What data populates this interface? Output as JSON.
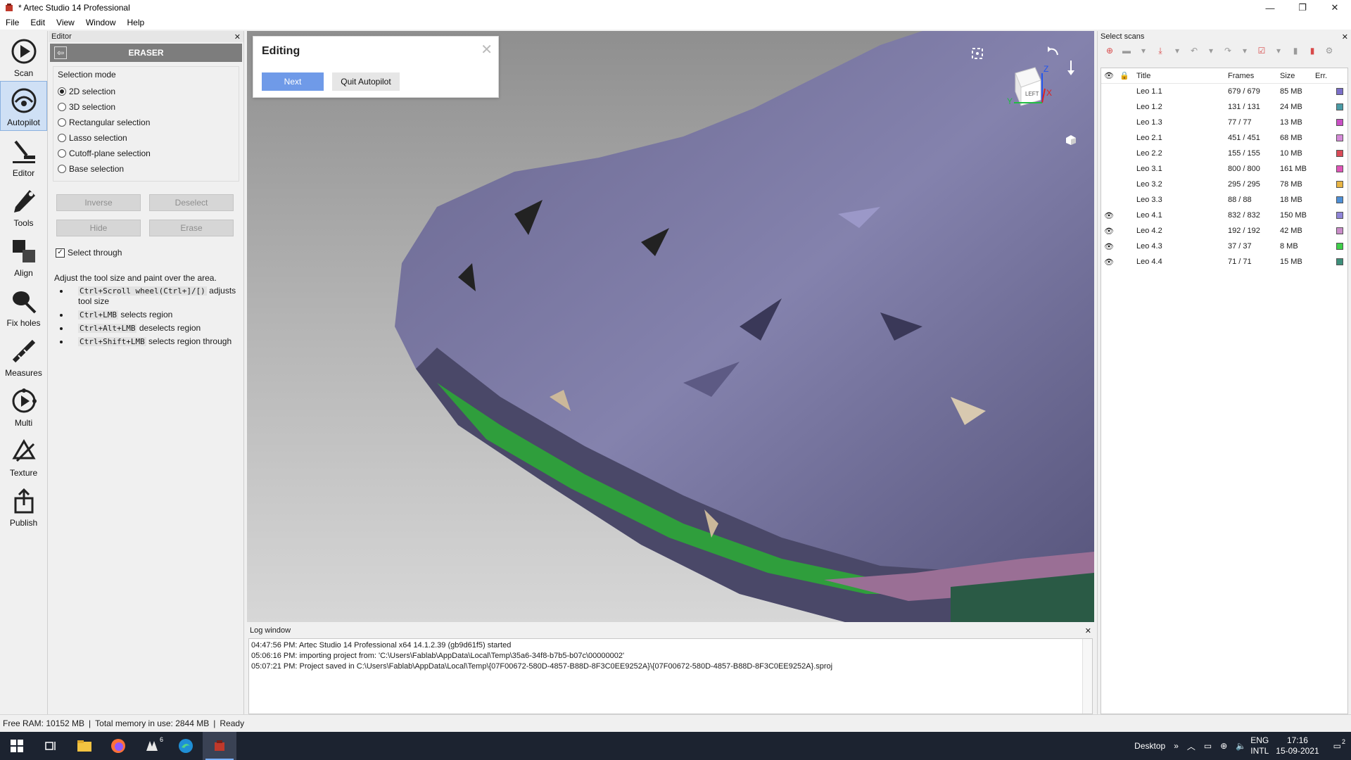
{
  "window": {
    "title": "* Artec Studio 14 Professional",
    "controls": [
      "—",
      "❐",
      "✕"
    ]
  },
  "menu": [
    "File",
    "Edit",
    "View",
    "Window",
    "Help"
  ],
  "tools": [
    {
      "label": "Scan",
      "icon": "scan-icon"
    },
    {
      "label": "Autopilot",
      "icon": "autopilot-icon",
      "active": true
    },
    {
      "label": "Editor",
      "icon": "editor-icon"
    },
    {
      "label": "Tools",
      "icon": "tools-icon"
    },
    {
      "label": "Align",
      "icon": "align-icon"
    },
    {
      "label": "Fix holes",
      "icon": "fix-holes-icon"
    },
    {
      "label": "Measures",
      "icon": "measures-icon"
    },
    {
      "label": "Multi",
      "icon": "multi-icon"
    },
    {
      "label": "Texture",
      "icon": "texture-icon"
    },
    {
      "label": "Publish",
      "icon": "publish-icon"
    }
  ],
  "editor": {
    "panel_title": "Editor",
    "mode_title": "ERASER",
    "selection_header": "Selection mode",
    "modes": [
      "2D selection",
      "3D selection",
      "Rectangular selection",
      "Lasso selection",
      "Cutoff-plane selection",
      "Base selection"
    ],
    "selected_mode": 0,
    "buttons": {
      "inverse": "Inverse",
      "deselect": "Deselect",
      "hide": "Hide",
      "erase": "Erase"
    },
    "select_through": "Select through",
    "help_intro": "Adjust the tool size and paint over the area.",
    "help_items": [
      {
        "keys": "Ctrl+Scroll wheel(Ctrl+]/[)",
        "text": " adjusts tool size"
      },
      {
        "keys": "Ctrl+LMB",
        "text": " selects region"
      },
      {
        "keys": "Ctrl+Alt+LMB",
        "text": " deselects region"
      },
      {
        "keys": "Ctrl+Shift+LMB",
        "text": " selects region through"
      }
    ]
  },
  "dialog": {
    "title": "Editing",
    "next": "Next",
    "quit": "Quit Autopilot",
    "close": "✕"
  },
  "viewcube": {
    "face": "LEFT",
    "axis_z": "Z",
    "axis_x": "X",
    "axis_y": "Y"
  },
  "log": {
    "title": "Log window",
    "lines": [
      "04:47:56 PM: Artec Studio 14 Professional x64 14.1.2.39 (gb9d61f5) started",
      "05:06:16 PM: importing project from: 'C:\\Users\\Fablab\\AppData\\Local\\Temp\\35a6-34f8-b7b5-b07c\\00000002'",
      "05:07:21 PM: Project saved in C:\\Users\\Fablab\\AppData\\Local\\Temp\\{07F00672-580D-4857-B88D-8F3C0EE9252A}\\{07F00672-580D-4857-B88D-8F3C0EE9252A}.sproj"
    ]
  },
  "scans": {
    "panel_title": "Select scans",
    "headers": {
      "title": "Title",
      "frames": "Frames",
      "size": "Size",
      "err": "Err."
    },
    "rows": [
      {
        "title": "Leo 1.1",
        "frames": "679 / 679",
        "size": "85 MB",
        "visible": false,
        "color": "#7b6fc9"
      },
      {
        "title": "Leo 1.2",
        "frames": "131 / 131",
        "size": "24 MB",
        "visible": false,
        "color": "#4a9ba6"
      },
      {
        "title": "Leo 1.3",
        "frames": "77 / 77",
        "size": "13 MB",
        "visible": false,
        "color": "#c94fc4"
      },
      {
        "title": "Leo 2.1",
        "frames": "451 / 451",
        "size": "68 MB",
        "visible": false,
        "color": "#d58ad8"
      },
      {
        "title": "Leo 2.2",
        "frames": "155 / 155",
        "size": "10 MB",
        "visible": false,
        "color": "#d94a57"
      },
      {
        "title": "Leo 3.1",
        "frames": "800 / 800",
        "size": "161 MB",
        "visible": false,
        "color": "#e055b9"
      },
      {
        "title": "Leo 3.2",
        "frames": "295 / 295",
        "size": "78 MB",
        "visible": false,
        "color": "#e8b443"
      },
      {
        "title": "Leo 3.3",
        "frames": "88 / 88",
        "size": "18 MB",
        "visible": false,
        "color": "#4d8fd6"
      },
      {
        "title": "Leo 4.1",
        "frames": "832 / 832",
        "size": "150 MB",
        "visible": true,
        "color": "#8f85d8"
      },
      {
        "title": "Leo 4.2",
        "frames": "192 / 192",
        "size": "42 MB",
        "visible": true,
        "color": "#c98cc8"
      },
      {
        "title": "Leo 4.3",
        "frames": "37 / 37",
        "size": "8 MB",
        "visible": true,
        "color": "#3fcf4a"
      },
      {
        "title": "Leo 4.4",
        "frames": "71 / 71",
        "size": "15 MB",
        "visible": true,
        "color": "#3d8f7a"
      }
    ]
  },
  "status": {
    "free_ram": "Free RAM: 10152 MB",
    "total_memory": "Total memory in use: 2844 MB",
    "state": "Ready",
    "sep": "|"
  },
  "taskbar": {
    "desktop": "Desktop",
    "lang1": "ENG",
    "lang2": "INTL",
    "time": "17:16",
    "date": "15-09-2021",
    "notifications": "2",
    "badge": "6"
  }
}
